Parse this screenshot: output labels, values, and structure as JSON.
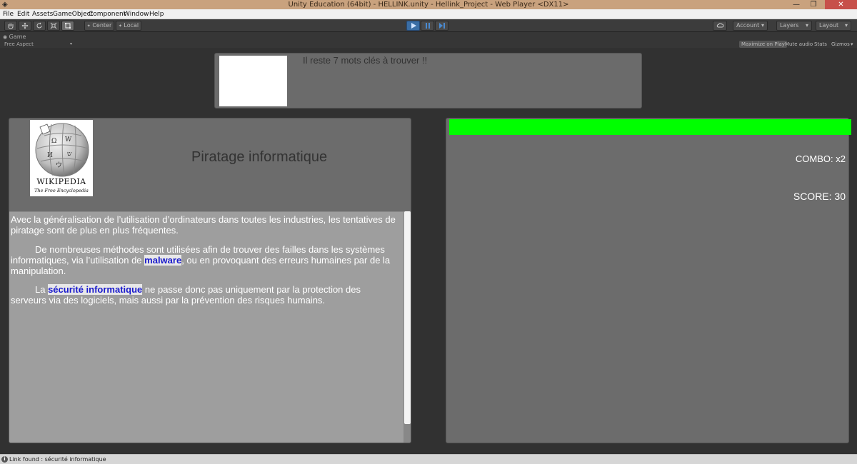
{
  "window": {
    "title": "Unity Education (64bit) - HELLINK.unity - Hellink_Project - Web Player <DX11>",
    "minimize_glyph": "—",
    "maximize_glyph": "❐",
    "close_glyph": "✕"
  },
  "menu": [
    "File",
    "Edit",
    "Assets",
    "GameObject",
    "Component",
    "Window",
    "Help"
  ],
  "toolbar": {
    "pivot_label": "Center",
    "space_label": "Local",
    "account_label": "Account",
    "layers_label": "Layers",
    "layout_label": "Layout",
    "dropdown_glyph": "▾"
  },
  "game_view": {
    "tab_label": "Game",
    "aspect_label": "Free Aspect",
    "aspect_arrow": "▾",
    "options": [
      "Maximize on Play",
      "Mute audio",
      "Stats",
      "Gizmos"
    ],
    "gizmos_arrow": "▾"
  },
  "hud": {
    "keywords_message": "Il reste 7 mots clés à trouver !!",
    "combo": "COMBO: x2",
    "score": "SCORE: 30",
    "health_fraction": 1.0,
    "health_color": "#00ff00"
  },
  "article": {
    "logo_name": "Wikipedia",
    "logo_line1": "WIKIPEDIA",
    "logo_line2": "The Free Encyclopedia",
    "title": "Piratage informatique",
    "p1": "Avec la généralisation de l’utilisation d’ordinateurs dans toutes les industries, les tentatives de piratage sont de plus en plus fréquentes.",
    "p2_before": "De nombreuses méthodes sont utilisées afin de trouver des failles dans les systèmes informatiques, via l’utilisation de ",
    "p2_link": "malware",
    "p2_after": ", ou en provoquant des erreurs humaines par de la manipulation.",
    "p3_before": "La ",
    "p3_link": "sécurité informatique",
    "p3_after": " ne passe donc pas uniquement par la protection des serveurs via des logiciels, mais aussi par la prévention des risques humains.",
    "link_color": "#1a1acc"
  },
  "status": {
    "icon": "i",
    "message": "Link found : sécurité informatique"
  }
}
